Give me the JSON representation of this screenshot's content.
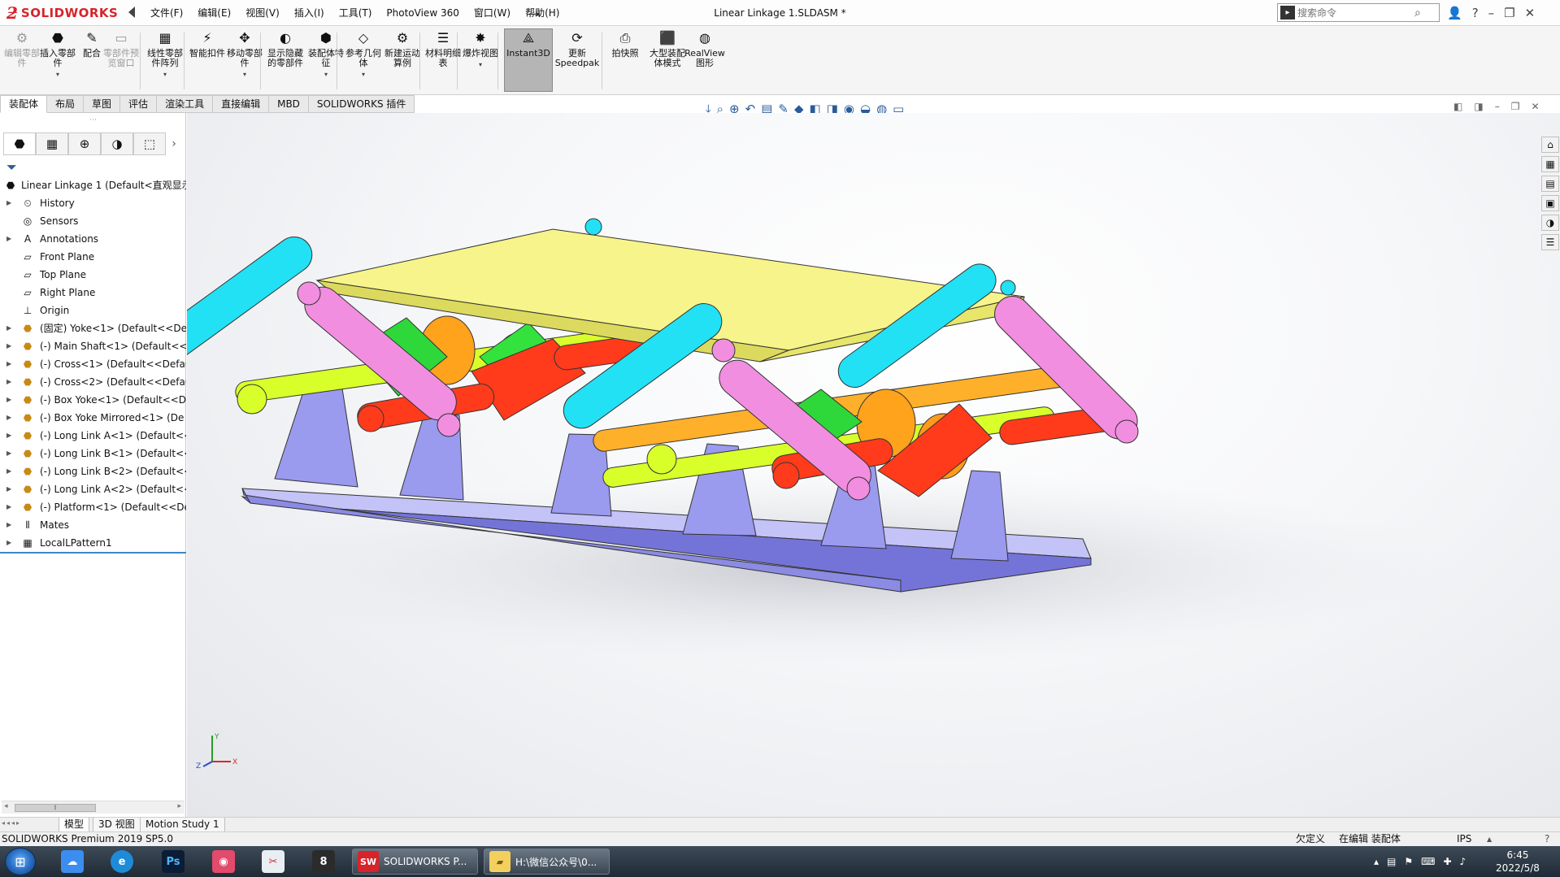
{
  "app": {
    "brand": "SOLIDWORKS",
    "doc_title": "Linear Linkage 1.SLDASM *",
    "menu": [
      "文件(F)",
      "编辑(E)",
      "视图(V)",
      "插入(I)",
      "工具(T)",
      "PhotoView 360",
      "窗口(W)",
      "帮助(H)"
    ],
    "search_placeholder": "搜索命令"
  },
  "toolbar": {
    "tools": [
      {
        "label": "编辑零部件",
        "disabled": true
      },
      {
        "label": "插入零部件",
        "disabled": false
      },
      {
        "label": "配合",
        "disabled": false
      },
      {
        "label": "零部件预览窗口",
        "disabled": true
      },
      {
        "label": "线性零部件阵列",
        "disabled": false
      },
      {
        "label": "智能扣件",
        "disabled": false
      },
      {
        "label": "移动零部件",
        "disabled": false
      },
      {
        "label": "显示隐藏的零部件",
        "disabled": false
      },
      {
        "label": "装配体特征",
        "disabled": false
      },
      {
        "label": "参考几何体",
        "disabled": false
      },
      {
        "label": "新建运动算例",
        "disabled": false
      },
      {
        "label": "材料明细表",
        "disabled": false
      },
      {
        "label": "爆炸视图",
        "disabled": false
      },
      {
        "label": "Instant3D",
        "disabled": false,
        "active": true
      },
      {
        "label": "更新Speedpak",
        "disabled": false
      },
      {
        "label": "拍快照",
        "disabled": false
      },
      {
        "label": "大型装配体模式",
        "disabled": false
      },
      {
        "label": "RealView图形",
        "disabled": false
      }
    ],
    "tabs": [
      "装配体",
      "布局",
      "草图",
      "评估",
      "渲染工具",
      "直接编辑",
      "MBD",
      "SOLIDWORKS 插件"
    ],
    "active_tab": "装配体"
  },
  "feature_tree": {
    "root": "Linear Linkage 1  (Default<直观显示",
    "nodes": [
      {
        "label": "History",
        "icon": "history-icon",
        "expandable": true
      },
      {
        "label": "Sensors",
        "icon": "sensors-icon",
        "expandable": false
      },
      {
        "label": "Annotations",
        "icon": "annotations-icon",
        "expandable": true
      },
      {
        "label": "Front Plane",
        "icon": "plane-icon",
        "expandable": false
      },
      {
        "label": "Top Plane",
        "icon": "plane-icon",
        "expandable": false
      },
      {
        "label": "Right Plane",
        "icon": "plane-icon",
        "expandable": false
      },
      {
        "label": "Origin",
        "icon": "origin-icon",
        "expandable": false
      },
      {
        "label": "(固定) Yoke<1> (Default<<Def",
        "icon": "part-icon",
        "expandable": true
      },
      {
        "label": "(-) Main Shaft<1> (Default<<D",
        "icon": "part-icon",
        "expandable": true
      },
      {
        "label": "(-) Cross<1> (Default<<Defau",
        "icon": "part-icon",
        "expandable": true
      },
      {
        "label": "(-) Cross<2> (Default<<Defau",
        "icon": "part-icon",
        "expandable": true
      },
      {
        "label": "(-) Box Yoke<1> (Default<<De",
        "icon": "part-icon",
        "expandable": true
      },
      {
        "label": "(-) Box Yoke Mirrored<1> (De",
        "icon": "part-icon",
        "expandable": true
      },
      {
        "label": "(-) Long Link A<1> (Default<<",
        "icon": "part-icon",
        "expandable": true
      },
      {
        "label": "(-) Long Link B<1> (Default<<",
        "icon": "part-icon",
        "expandable": true
      },
      {
        "label": "(-) Long Link B<2> (Default<<",
        "icon": "part-icon",
        "expandable": true
      },
      {
        "label": "(-) Long Link A<2> (Default<<",
        "icon": "part-icon",
        "expandable": true
      },
      {
        "label": "(-) Platform<1> (Default<<Def",
        "icon": "part-icon",
        "expandable": true
      },
      {
        "label": "Mates",
        "icon": "mates-icon",
        "expandable": true
      },
      {
        "label": "LocalLPattern1",
        "icon": "pattern-icon",
        "expandable": true
      }
    ]
  },
  "triad": {
    "x": "X",
    "y": "Y",
    "z": "Z"
  },
  "bottom_tabs": [
    "模型",
    "3D 视图",
    "Motion Study 1"
  ],
  "status": {
    "product": "SOLIDWORKS Premium 2019 SP5.0",
    "state": "欠定义",
    "mode": "在编辑 装配体",
    "units": "IPS"
  },
  "taskbar": {
    "windows": [
      {
        "label": "SOLIDWORKS P...",
        "icon": "solidworks-icon"
      },
      {
        "label": "H:\\微信公众号\\0...",
        "icon": "folder-icon"
      }
    ],
    "time": "6:45",
    "date": "2022/5/8"
  },
  "colors": {
    "base": "#9b9bef",
    "platform": "#f6f48a",
    "cyan_link": "#22e1f4",
    "pink_link": "#f28ee0",
    "shaft": "#d9ff2b",
    "cross": "#ff3b1c",
    "yoke": "#ff9b1a",
    "green": "#33e23a"
  }
}
